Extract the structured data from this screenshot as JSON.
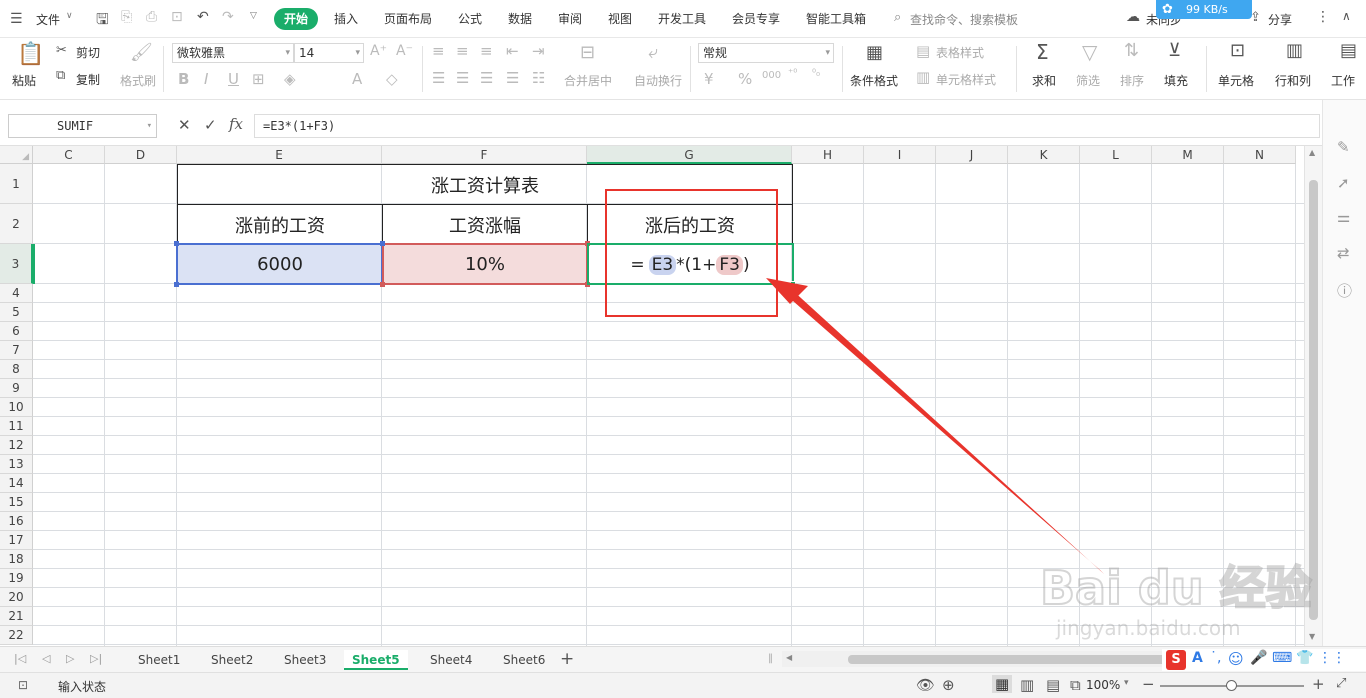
{
  "menubar": {
    "file_label": "文件",
    "tabs": [
      "开始",
      "插入",
      "页面布局",
      "公式",
      "数据",
      "审阅",
      "视图",
      "开发工具",
      "会员专享",
      "智能工具箱"
    ],
    "active_tab": "开始",
    "search_placeholder": "查找命令、搜索模板",
    "unsynced_label": "未同步",
    "speed_label": "99 KB/s",
    "share_label": "分享"
  },
  "ribbon": {
    "paste": "粘贴",
    "cut": "剪切",
    "copy": "复制",
    "format_painter": "格式刷",
    "font_name": "微软雅黑",
    "font_size": "14",
    "merge_center": "合并居中",
    "wrap_text": "自动换行",
    "number_format": "常规",
    "conditional_format": "条件格式",
    "table_style": "表格样式",
    "cell_style": "单元格样式",
    "sum": "求和",
    "filter": "筛选",
    "sort": "排序",
    "fill": "填充",
    "cell": "单元格",
    "row_col": "行和列",
    "worksheet": "工作"
  },
  "formula_bar": {
    "name_box": "SUMIF",
    "fx": "fx",
    "formula": "=E3*(1+F3)"
  },
  "columns": [
    "C",
    "D",
    "E",
    "F",
    "G",
    "H",
    "I",
    "J",
    "K",
    "L",
    "M",
    "N"
  ],
  "rows": [
    "1",
    "2",
    "3",
    "4",
    "5",
    "6",
    "7",
    "8",
    "9",
    "10",
    "11",
    "12",
    "13",
    "14",
    "15",
    "16",
    "17",
    "18",
    "19",
    "20",
    "21",
    "22"
  ],
  "table": {
    "title": "涨工资计算表",
    "headers": [
      "涨前的工资",
      "工资涨幅",
      "涨后的工资"
    ],
    "values": [
      "6000",
      "10%"
    ],
    "formula_parts": [
      "=",
      "E3",
      "*(1+",
      "F3",
      ")"
    ]
  },
  "sheets": [
    "Sheet1",
    "Sheet2",
    "Sheet3",
    "Sheet5",
    "Sheet4",
    "Sheet6"
  ],
  "active_sheet": "Sheet5",
  "status": {
    "mode": "输入状态",
    "zoom": "100%"
  },
  "watermark": {
    "brand": "Bai du 经验",
    "url": "jingyan.baidu.com"
  },
  "colors": {
    "accent": "#1aad6a",
    "e3_fill": "#dbe2f4",
    "f3_fill": "#f4dcdc",
    "callout": "#e8342c"
  }
}
